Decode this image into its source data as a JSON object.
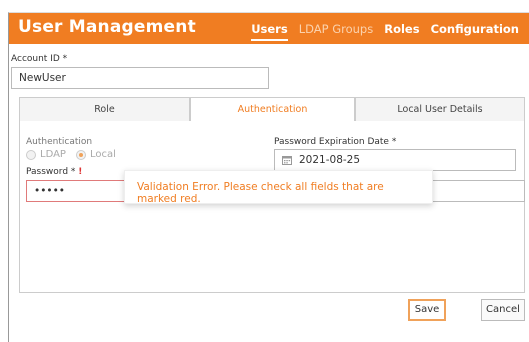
{
  "header": {
    "title": "User Management",
    "nav": [
      "Users",
      "LDAP Groups",
      "Roles",
      "Configuration"
    ],
    "active_nav": "Users",
    "accent_color": "#f07d22"
  },
  "account": {
    "label": "Account ID",
    "required_mark": "*",
    "value": "NewUser"
  },
  "tabs": [
    "Role",
    "Authentication",
    "Local User Details"
  ],
  "active_tab": "Authentication",
  "auth": {
    "label": "Authentication",
    "options": [
      "LDAP",
      "Local"
    ],
    "selected": "Local"
  },
  "expiration": {
    "label": "Password Expiration Date",
    "required_mark": "*",
    "value": "2021-08-25",
    "icon": "calendar-icon"
  },
  "password": {
    "label": "Password",
    "required_mark": "*",
    "error_mark": "!",
    "value": "•••••"
  },
  "toast": {
    "message": "Validation Error. Please check all fields that are marked red."
  },
  "buttons": {
    "save": "Save",
    "cancel": "Cancel"
  }
}
